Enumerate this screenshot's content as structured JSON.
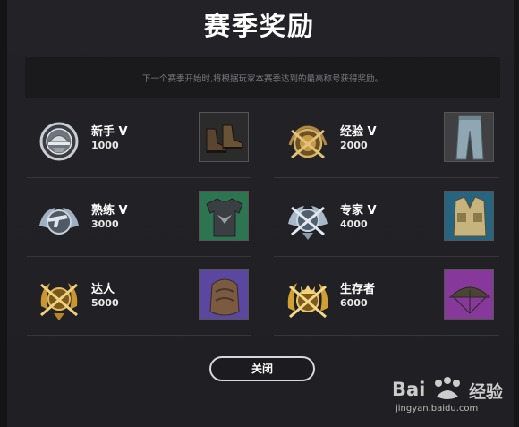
{
  "dialog": {
    "title": "赛季奖励",
    "notice": "下一个赛季开始时,将根据玩家本赛季达到的最高称号获得奖励。",
    "close_label": "关闭"
  },
  "ranks": [
    {
      "name": "新手 V",
      "points": "1000",
      "badge_icon": "silver-helmet-badge-icon",
      "reward_icon": "boots-icon",
      "reward_bg": "#2e2f2e",
      "badge_color": "#c9ccd2"
    },
    {
      "name": "经验 V",
      "points": "2000",
      "badge_icon": "gold-crossed-pans-badge-icon",
      "reward_icon": "jeans-icon",
      "reward_bg": "#3f3f40",
      "badge_color": "#caa457"
    },
    {
      "name": "熟练 V",
      "points": "3000",
      "badge_icon": "silver-pistol-wings-badge-icon",
      "reward_icon": "tshirt-icon",
      "reward_bg": "#2f7a52",
      "badge_color": "#b9c4d2"
    },
    {
      "name": "专家 V",
      "points": "4000",
      "badge_icon": "silver-rifles-wings-badge-icon",
      "reward_icon": "vest-icon",
      "reward_bg": "#2a6a86",
      "badge_color": "#b9c4d2"
    },
    {
      "name": "达人",
      "points": "5000",
      "badge_icon": "gold-rifles-wreath-badge-icon",
      "reward_icon": "backpack-icon",
      "reward_bg": "#5d4ba3",
      "badge_color": "#d3a53a"
    },
    {
      "name": "生存者",
      "points": "6000",
      "badge_icon": "gold-crowned-rifles-badge-icon",
      "reward_icon": "parachute-icon",
      "reward_bg": "#8a3c9e",
      "badge_color": "#d8aa3a"
    }
  ],
  "watermark": {
    "brand": "Bai",
    "brand_cn": "经验",
    "url": "jingyan.baidu.com"
  }
}
